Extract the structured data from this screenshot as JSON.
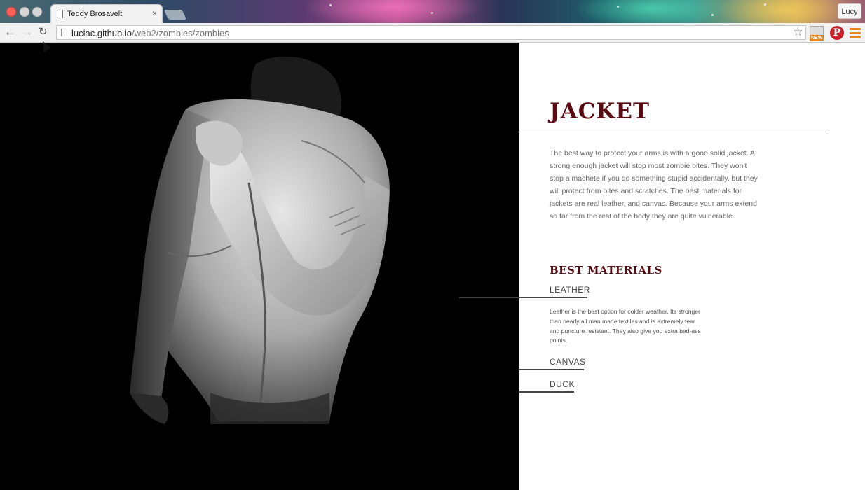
{
  "browser": {
    "tab_title": "Teddy Brosavelt",
    "tab_close": "×",
    "profile_name": "Lucy",
    "url_host": "luciac.github.io",
    "url_path": "/web2/zombies/zombies",
    "ext_new_label": "NEW",
    "pinterest_glyph": "P",
    "back_glyph": "←",
    "forward_glyph": "→",
    "reload_glyph": "↻",
    "star_glyph": "☆",
    "icons": [
      "page-icon",
      "back-arrow-icon",
      "forward-arrow-icon",
      "reload-icon",
      "bookmark-star-icon",
      "new-extension-icon",
      "pinterest-icon",
      "menu-icon"
    ]
  },
  "hero": {
    "image": "man in white leather jacket on black background"
  },
  "content": {
    "title": "JACKET",
    "description": "The best way to protect your arms is with a good solid jacket. A strong enough jacket will stop most zombie bites. They won't stop a machete if you do something stupid accidentally, but they will protect from bites and scratches. The best materials for jackets are real leather, and canvas. Because your arms extend so far from the rest of the body they are quite vulnerable.",
    "section_heading": "BEST MATERIALS",
    "materials": [
      {
        "name": "LEATHER",
        "description": "Leather is the best option for colder weather. Its stronger than nearly all man made textiles and is extremely tear and puncture resistant. They also give you extra bad-ass points."
      },
      {
        "name": "CANVAS"
      },
      {
        "name": "DUCK"
      }
    ]
  },
  "colors": {
    "heading_maroon": "#5a0c12",
    "hero_background": "#000000",
    "close_red": "#ff5f57",
    "accent_orange": "#e8871e",
    "pinterest_red": "#c8232c"
  }
}
